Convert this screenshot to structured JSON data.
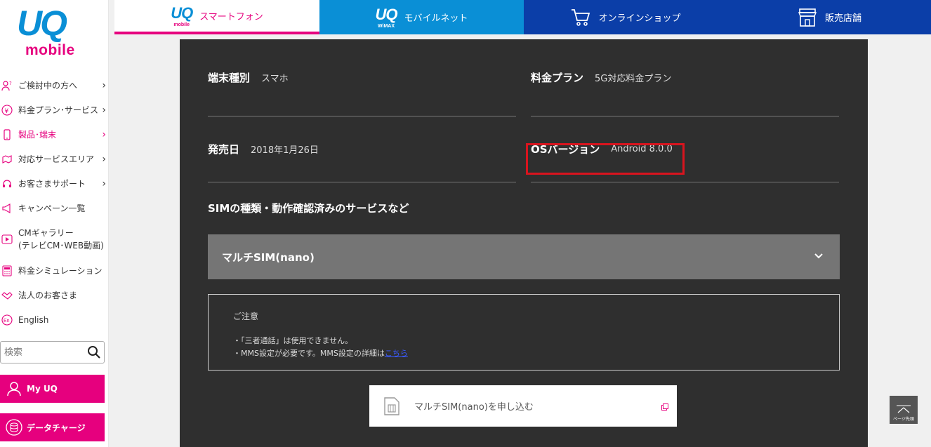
{
  "logo": {
    "top": "UQ",
    "bottom": "mobile"
  },
  "sidebar": {
    "items": [
      {
        "label": "ご検討中の方へ",
        "icon": "person-question-icon",
        "chevron": true
      },
      {
        "label": "料金プラン･サービス",
        "icon": "yen-icon",
        "chevron": true
      },
      {
        "label": "製品･端末",
        "icon": "smartphone-icon",
        "chevron": true,
        "active": true
      },
      {
        "label": "対応サービスエリア",
        "icon": "map-pin-icon",
        "chevron": true
      },
      {
        "label": "お客さまサポート",
        "icon": "headset-icon",
        "chevron": true
      },
      {
        "label": "キャンペーン一覧",
        "icon": "megaphone-icon",
        "chevron": false
      },
      {
        "label": "CMギャラリー",
        "label2": "(テレビCM･WEB動画)",
        "icon": "play-icon",
        "chevron": false
      },
      {
        "label": "料金シミュレーション",
        "icon": "calculator-icon",
        "chevron": false
      },
      {
        "label": "法人のお客さま",
        "icon": "handshake-icon",
        "chevron": false
      },
      {
        "label": "English",
        "icon": "en-icon",
        "chevron": false
      }
    ],
    "search_placeholder": "検索",
    "myuq_label": "My UQ",
    "data_charge_label": "データチャージ"
  },
  "topnav": {
    "phone": {
      "logo_big": "UQ",
      "logo_small": "mobile",
      "label": "スマートフォン"
    },
    "wimax": {
      "logo_big": "UQ",
      "logo_small": "WiMAX",
      "label": "モバイルネット"
    },
    "shop": {
      "label": "オンラインショップ"
    },
    "store": {
      "label": "販売店舗"
    }
  },
  "specs": {
    "device_type": {
      "label": "端末種別",
      "value": "スマホ"
    },
    "plan": {
      "label": "料金プラン",
      "value": "5G対応料金プラン"
    },
    "release": {
      "label": "発売日",
      "value": "2018年1月26日"
    },
    "os": {
      "label": "OSバージョン",
      "value": "Android 8.0.0"
    }
  },
  "sim_section_title": "SIMの種類・動作確認済みのサービスなど",
  "accordion_label": "マルチSIM(nano)",
  "notice": {
    "title": "ご注意",
    "line1": "・「三者通話」は使用できません。",
    "line2_prefix": "・MMS設定が必要です。MMS設定の詳細は",
    "line2_link": "こちら"
  },
  "apply_label": "マルチSIM(nano)を申し込む",
  "pagetop_label": "ページ先頭",
  "colors": {
    "brand_pink": "#e6007e",
    "brand_blue": "#0a8fd6",
    "navy": "#0b3ea8",
    "panel": "#2f2f2f",
    "highlight": "#d9141e"
  }
}
